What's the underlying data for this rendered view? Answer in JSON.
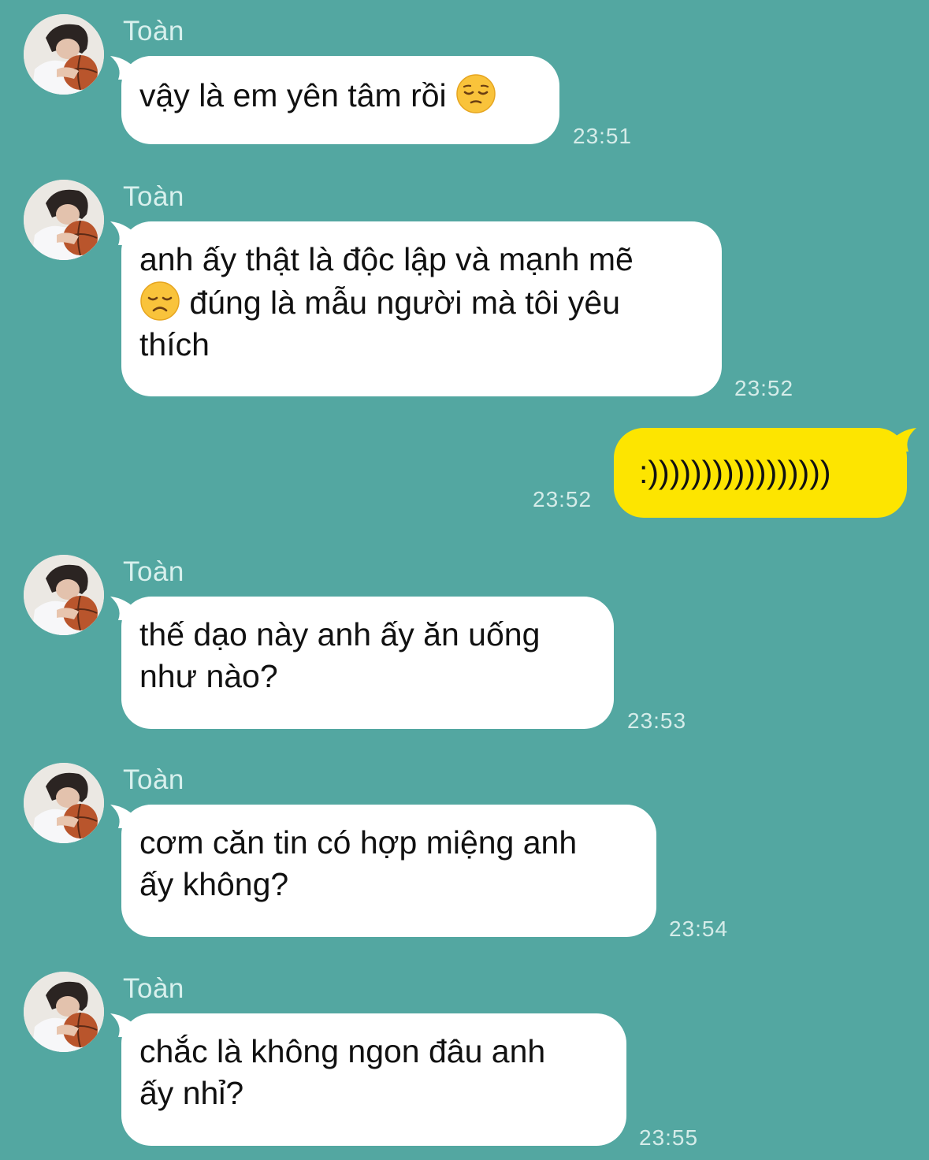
{
  "conversation": {
    "contact_name": "Toàn",
    "messages": [
      {
        "sender": "Toàn",
        "direction": "incoming",
        "line1": "vậy là em yên tâm rồi",
        "emoji": "pensive-face-emoji",
        "time": "23:51"
      },
      {
        "sender": "Toàn",
        "direction": "incoming",
        "line1": "anh ấy thật là độc lập và mạnh mẽ",
        "emoji": "disappointed-face-emoji",
        "line2": "đúng là mẫu người mà tôi yêu",
        "line3": "thích",
        "time": "23:52"
      },
      {
        "sender": "me",
        "direction": "outgoing",
        "text": ":)))))))))))))))))",
        "time": "23:52"
      },
      {
        "sender": "Toàn",
        "direction": "incoming",
        "line1": "thế dạo này anh ấy ăn uống",
        "line2": "như nào?",
        "time": "23:53"
      },
      {
        "sender": "Toàn",
        "direction": "incoming",
        "line1": "cơm căn tin có hợp miệng anh",
        "line2": "ấy không?",
        "time": "23:54"
      },
      {
        "sender": "Toàn",
        "direction": "incoming",
        "line1": "chắc là không ngon đâu anh",
        "line2": "ấy nhỉ?",
        "time": "23:55"
      }
    ]
  },
  "colors": {
    "background": "#53a7a1",
    "incoming_bubble": "#ffffff",
    "outgoing_bubble": "#fde500",
    "meta_text": "#d5ece9"
  }
}
